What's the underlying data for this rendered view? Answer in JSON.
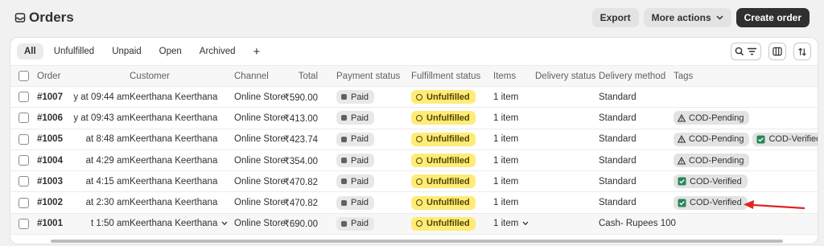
{
  "header": {
    "title": "Orders",
    "export_label": "Export",
    "more_actions_label": "More actions",
    "create_label": "Create order"
  },
  "tabs": [
    {
      "label": "All",
      "active": true
    },
    {
      "label": "Unfulfilled"
    },
    {
      "label": "Unpaid"
    },
    {
      "label": "Open"
    },
    {
      "label": "Archived"
    },
    {
      "label": "+"
    }
  ],
  "columns": [
    "Order",
    "Customer",
    "Channel",
    "Total",
    "Payment status",
    "Fulfillment status",
    "Items",
    "Delivery status",
    "Delivery method",
    "Tags"
  ],
  "rows": [
    {
      "order": "#1007",
      "date": "y at 09:44 am",
      "customer": "Keerthana Keerthana",
      "channel": "Online Store",
      "total": "₹590.00",
      "payment": "Paid",
      "fulfillment": "Unfulfilled",
      "items": "1 item",
      "delivery_method": "Standard",
      "tags": []
    },
    {
      "order": "#1006",
      "date": "y at 09:43 am",
      "customer": "Keerthana Keerthana",
      "channel": "Online Store",
      "total": "₹413.00",
      "payment": "Paid",
      "fulfillment": "Unfulfilled",
      "items": "1 item",
      "delivery_method": "Standard",
      "tags": [
        {
          "label": "COD-Pending",
          "icon": "warning-icon"
        }
      ]
    },
    {
      "order": "#1005",
      "date": "at 8:48 am",
      "customer": "Keerthana Keerthana",
      "channel": "Online Store",
      "total": "₹423.74",
      "payment": "Paid",
      "fulfillment": "Unfulfilled",
      "items": "1 item",
      "delivery_method": "Standard",
      "tags": [
        {
          "label": "COD-Pending",
          "icon": "warning-icon"
        },
        {
          "label": "COD-Verified",
          "icon": "check-icon"
        }
      ]
    },
    {
      "order": "#1004",
      "date": "at 4:29 am",
      "customer": "Keerthana Keerthana",
      "channel": "Online Store",
      "total": "₹354.00",
      "payment": "Paid",
      "fulfillment": "Unfulfilled",
      "items": "1 item",
      "delivery_method": "Standard",
      "tags": [
        {
          "label": "COD-Pending",
          "icon": "warning-icon"
        }
      ]
    },
    {
      "order": "#1003",
      "date": "at 4:15 am",
      "customer": "Keerthana Keerthana",
      "channel": "Online Store",
      "total": "₹470.82",
      "payment": "Paid",
      "fulfillment": "Unfulfilled",
      "items": "1 item",
      "delivery_method": "Standard",
      "tags": [
        {
          "label": "COD-Verified",
          "icon": "check-icon"
        }
      ]
    },
    {
      "order": "#1002",
      "date": "at 2:30 am",
      "customer": "Keerthana Keerthana",
      "channel": "Online Store",
      "total": "₹470.82",
      "payment": "Paid",
      "fulfillment": "Unfulfilled",
      "items": "1 item",
      "delivery_method": "Standard",
      "tags": [
        {
          "label": "COD-Verified",
          "icon": "check-icon"
        }
      ]
    },
    {
      "order": "#1001",
      "date": "t 1:50 am",
      "customer": "Keerthana Keerthana",
      "channel": "Online Store",
      "total": "₹690.00",
      "payment": "Paid",
      "fulfillment": "Unfulfilled",
      "items": "1 item",
      "delivery_method": "Cash- Rupees 100",
      "tags": [],
      "hover": true
    }
  ],
  "colors": {
    "primary_button": "#303030",
    "unfulfilled_badge": "#ffeb78",
    "tag_bg": "#e3e3e3",
    "verified_check": "#29845a",
    "annotation_arrow": "#e02424"
  }
}
